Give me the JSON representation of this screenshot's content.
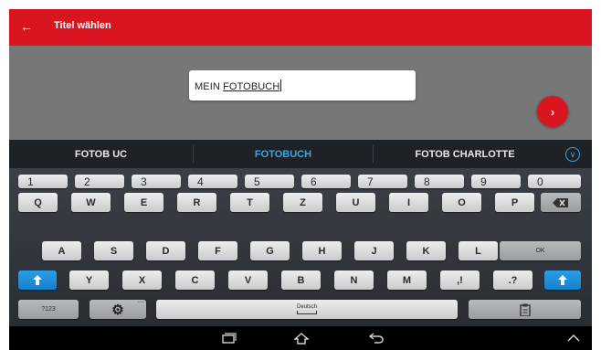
{
  "header": {
    "back_icon": "arrow-left-icon",
    "title": "Titel wählen"
  },
  "input": {
    "prefix": "MEIN ",
    "word": "FOTOBUCH"
  },
  "next_button": {
    "icon": "chevron-right-icon",
    "glyph": "›"
  },
  "suggestions": [
    "FOTOB UC",
    "FOTOBUCH",
    "FOTOB CHARLOTTE"
  ],
  "suggestion_expand_icon": "chevron-down-circle-icon",
  "keyboard": {
    "row_numbers": [
      "1",
      "2",
      "3",
      "4",
      "5",
      "6",
      "7",
      "8",
      "9",
      "0"
    ],
    "row1": [
      "Q",
      "W",
      "E",
      "R",
      "T",
      "Z",
      "U",
      "I",
      "O",
      "P"
    ],
    "row2": [
      "A",
      "S",
      "D",
      "F",
      "G",
      "H",
      "J",
      "K",
      "L"
    ],
    "row3": [
      "Y",
      "X",
      "C",
      "V",
      "B",
      "N",
      "M"
    ],
    "ok_label": "OK",
    "comma_label": ",!",
    "period_label": ".?",
    "symbols_label": "?123",
    "space_label": "Deutsch",
    "icons": [
      "backspace-icon",
      "shift-icon",
      "settings-icon",
      "clipboard-icon"
    ]
  },
  "nav": {
    "icons": [
      "recent-apps-icon",
      "home-icon",
      "back-icon",
      "hide-keyboard-icon"
    ]
  },
  "colors": {
    "accent": "#d9151f",
    "highlight": "#3aa6e8",
    "shift": "#1e8fd8"
  }
}
